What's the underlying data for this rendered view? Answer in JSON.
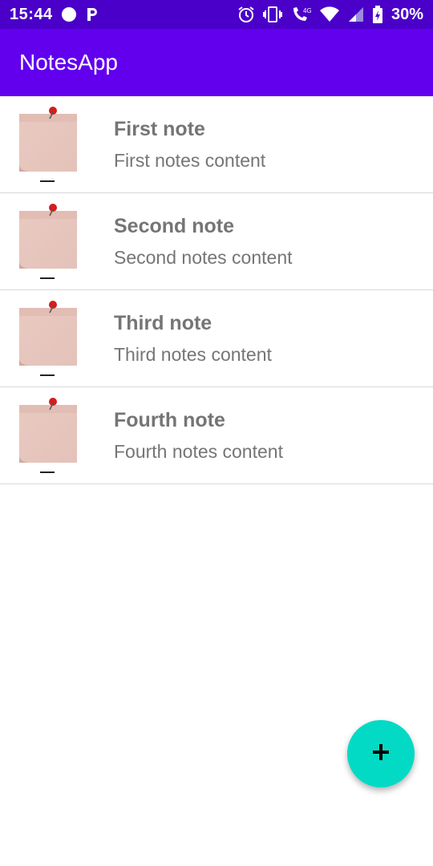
{
  "status_bar": {
    "time": "15:44",
    "network": "4G",
    "battery": "30%",
    "icons": [
      "circle-icon",
      "p-icon",
      "alarm-icon",
      "vibrate-icon",
      "wifi-call-icon",
      "wifi-icon",
      "signal-icon",
      "battery-icon"
    ]
  },
  "app_bar": {
    "title": "NotesApp",
    "color": "#6200ee"
  },
  "notes": [
    {
      "title": "First note",
      "content": "First notes content"
    },
    {
      "title": "Second note",
      "content": "Second notes content"
    },
    {
      "title": "Third note",
      "content": "Third notes content"
    },
    {
      "title": "Fourth note",
      "content": "Fourth notes content"
    }
  ],
  "fab": {
    "icon": "plus-icon",
    "color": "#03dac5"
  }
}
